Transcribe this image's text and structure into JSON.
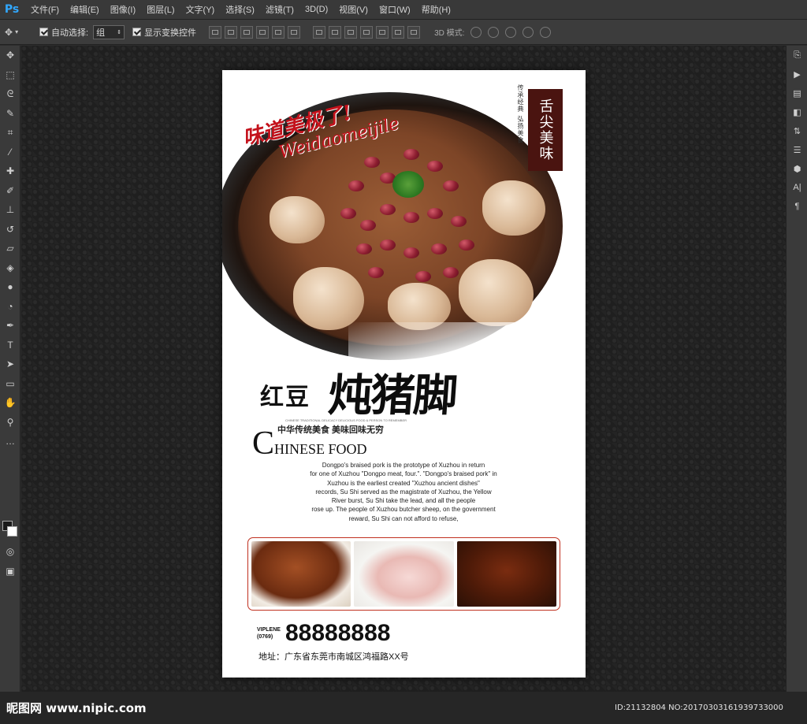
{
  "app": {
    "logo": "Ps",
    "menu": [
      "文件(F)",
      "编辑(E)",
      "图像(I)",
      "图层(L)",
      "文字(Y)",
      "选择(S)",
      "滤镜(T)",
      "3D(D)",
      "视图(V)",
      "窗口(W)",
      "帮助(H)"
    ]
  },
  "options_bar": {
    "auto_select_label": "自动选择:",
    "auto_select_value": "组",
    "show_transform_label": "显示变换控件",
    "mode_3d_label": "3D 模式:"
  },
  "poster": {
    "script_cn": "味道美极了!",
    "script_en": "Weidaomeijile",
    "badge": "舌尖美味",
    "side_note": "传承经典 弘扬美食",
    "title_small": "红豆",
    "title_big": "炖猪脚",
    "cn_tagline": "中华传统美食  美味回味无穷",
    "cn_tiny": "CHINESE TRADITIONAL DELICACY DELICIOUS FOOD & PERSON TO REMEMBER",
    "en_head_cap": "C",
    "en_head_rest": "HINESE FOOD",
    "description": [
      "Dongpo's braised pork is the prototype of Xuzhou in return",
      "for one of Xuzhou \"Dongpo meat, four.\". \"Dongpo's braised pork\" in",
      "Xuzhou is the earliest created \"Xuzhou ancient dishes\"",
      "records, Su Shi served as the magistrate of Xuzhou, the Yellow",
      "River burst, Su Shi take the lead, and all the people",
      "rose up. The people of Xuzhou butcher sheep, on the government",
      "reward, Su Shi can not afford to refuse,"
    ],
    "phone_label_1": "VIPLENE",
    "phone_label_2": "(0769)",
    "phone_number": "88888888",
    "address": "地址：广东省东莞市南城区鸿福路XX号"
  },
  "watermark": {
    "left": "昵图网 www.nipic.com",
    "right": "ID:21132804 NO:20170303161939733000"
  },
  "colors": {
    "accent_red": "#c4121c",
    "badge_bg": "#4a1410",
    "ps_blue": "#31a8ff"
  }
}
